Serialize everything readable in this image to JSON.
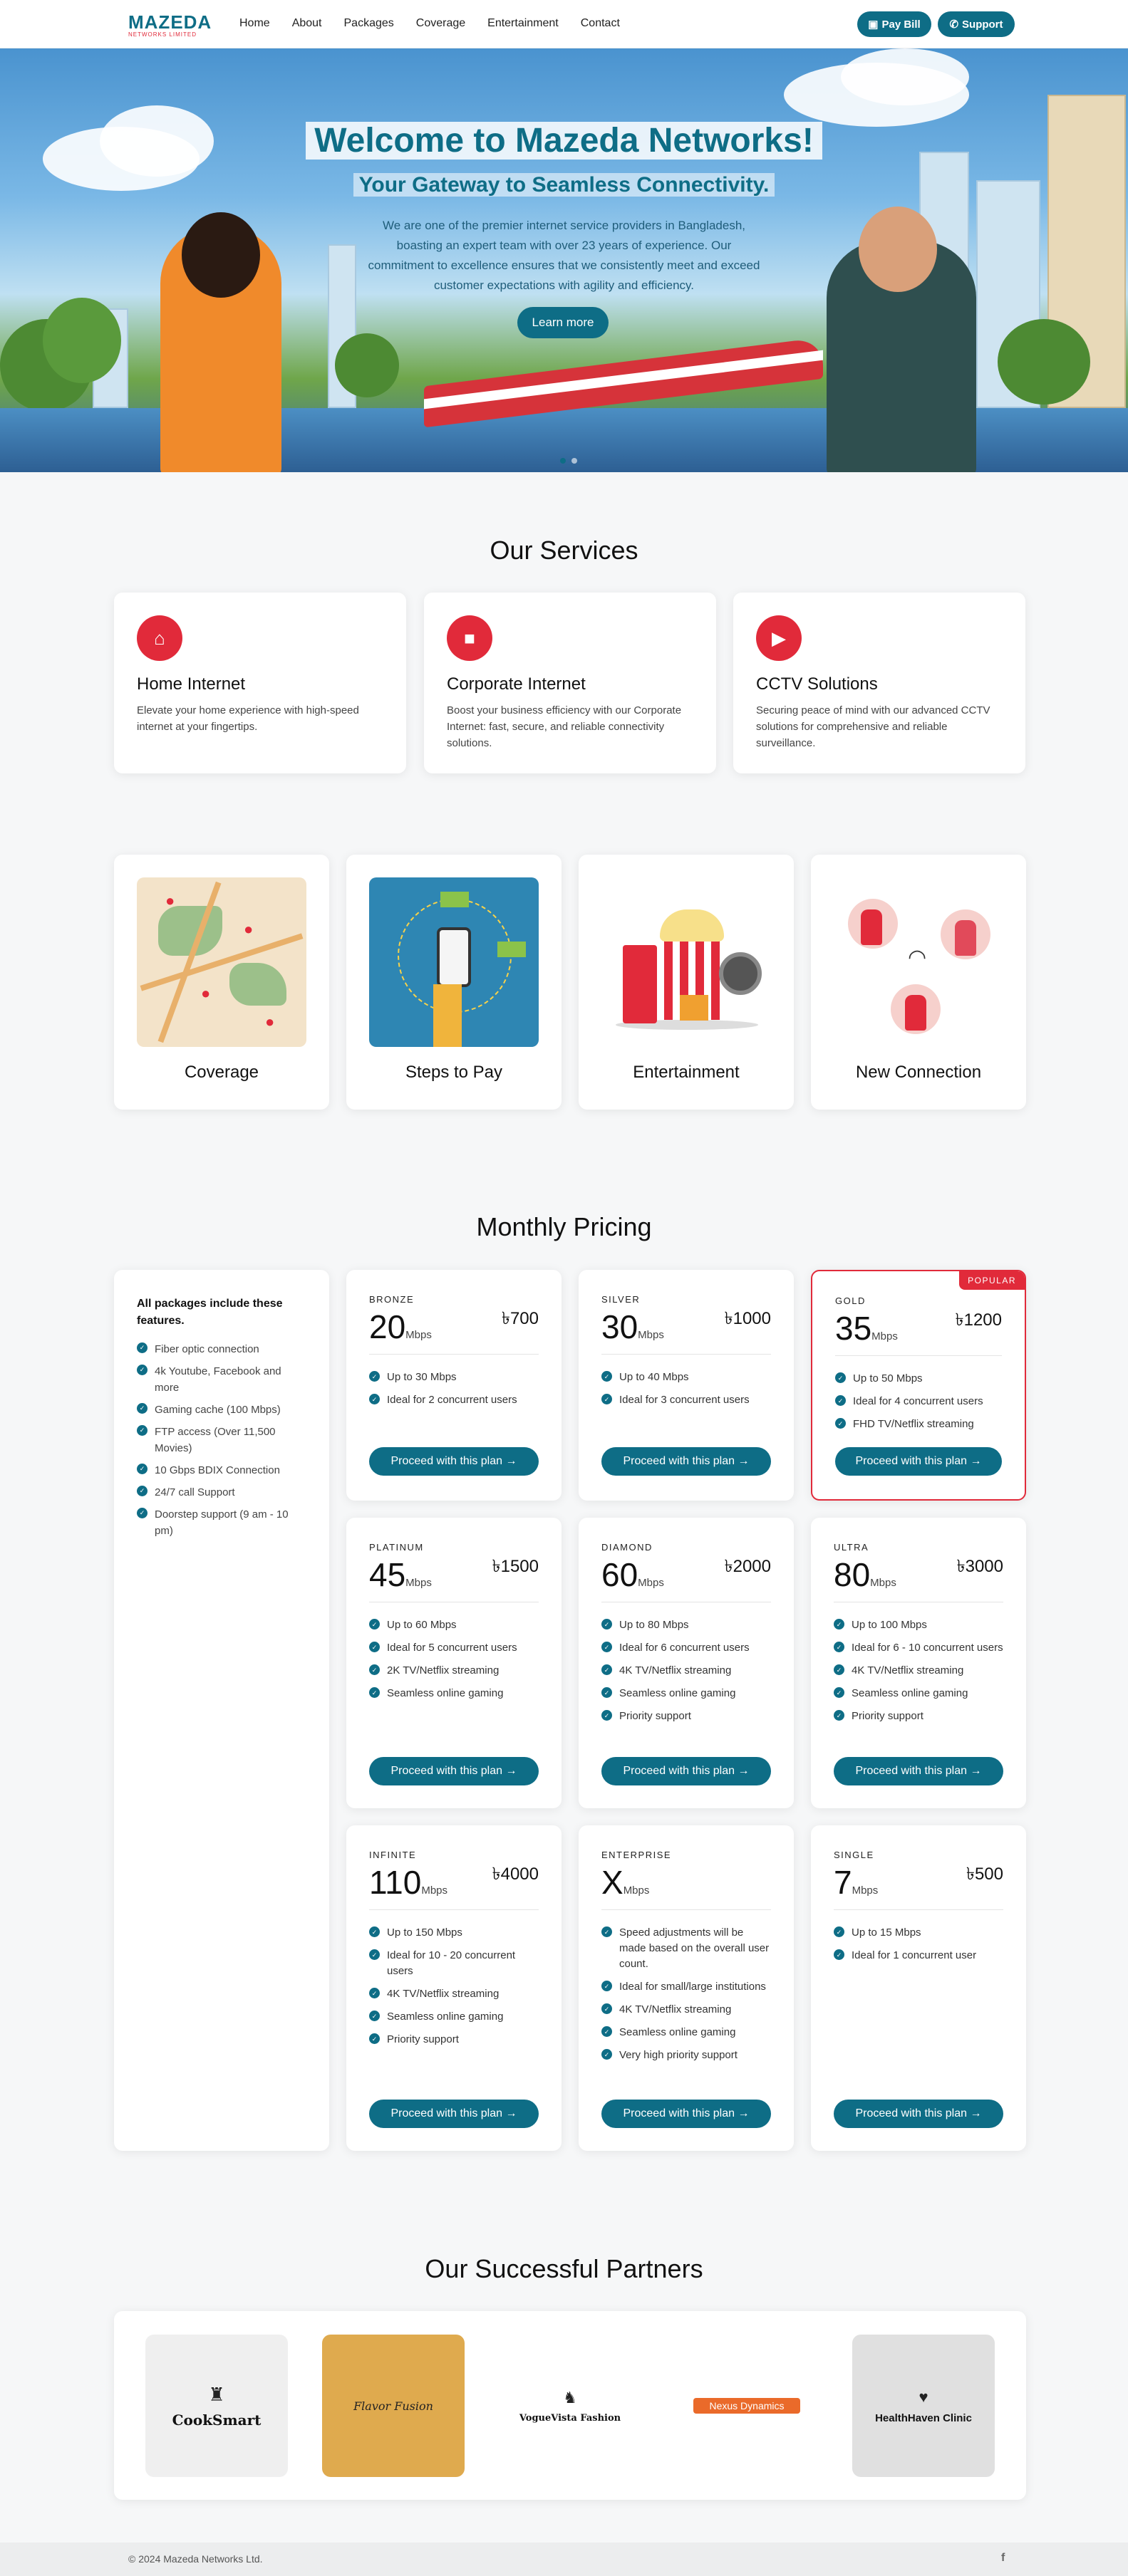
{
  "nav": {
    "logo_main": "MAZEDA",
    "logo_sub": "NETWORKS LIMITED",
    "links": [
      "Home",
      "About",
      "Packages",
      "Coverage",
      "Entertainment",
      "Contact"
    ],
    "pay_bill": "Pay Bill",
    "support": "Support"
  },
  "hero": {
    "title": "Welcome to Mazeda Networks!",
    "subtitle": "Your Gateway to Seamless Connectivity.",
    "text": "We are one of the premier internet service providers in Bangladesh, boasting an expert team with over 23 years of experience. Our commitment to excellence ensures that we consistently meet and exceed customer expectations with agility and efficiency.",
    "button": "Learn more"
  },
  "services": {
    "title": "Our Services",
    "items": [
      {
        "title": "Home Internet",
        "desc": "Elevate your home experience with high-speed internet at your fingertips.",
        "icon": "home-wifi-icon"
      },
      {
        "title": "Corporate Internet",
        "desc": "Boost your business efficiency with our Corporate Internet: fast, secure, and reliable connectivity solutions.",
        "icon": "briefcase-icon"
      },
      {
        "title": "CCTV Solutions",
        "desc": "Securing peace of mind with our advanced CCTV solutions for comprehensive and reliable surveillance.",
        "icon": "video-camera-icon"
      }
    ]
  },
  "features": [
    "Coverage",
    "Steps to Pay",
    "Entertainment",
    "New Connection"
  ],
  "pricing": {
    "title": "Monthly Pricing",
    "includes_title": "All packages include these features.",
    "includes": [
      "Fiber optic connection",
      "4k Youtube, Facebook and more",
      "Gaming cache (100 Mbps)",
      "FTP access (Over 11,500 Movies)",
      "10 Gbps BDIX Connection",
      "24/7 call Support",
      "Doorstep support (9 am - 10 pm)"
    ],
    "unit": "Mbps",
    "button": "Proceed with this plan",
    "popular": "POPULAR",
    "plans": [
      {
        "tier": "BRONZE",
        "speed": "20",
        "price": "৳700",
        "features": [
          "Up to 30 Mbps",
          "Ideal for 2 concurrent users"
        ]
      },
      {
        "tier": "SILVER",
        "speed": "30",
        "price": "৳1000",
        "features": [
          "Up to 40 Mbps",
          "Ideal for 3 concurrent users"
        ]
      },
      {
        "tier": "GOLD",
        "speed": "35",
        "price": "৳1200",
        "features": [
          "Up to 50 Mbps",
          "Ideal for 4 concurrent users",
          "FHD TV/Netflix streaming"
        ]
      },
      {
        "tier": "PLATINUM",
        "speed": "45",
        "price": "৳1500",
        "features": [
          "Up to 60 Mbps",
          "Ideal for 5 concurrent users",
          "2K TV/Netflix streaming",
          "Seamless online gaming"
        ]
      },
      {
        "tier": "DIAMOND",
        "speed": "60",
        "price": "৳2000",
        "features": [
          "Up to 80 Mbps",
          "Ideal for 6 concurrent users",
          "4K TV/Netflix streaming",
          "Seamless online gaming",
          "Priority support"
        ]
      },
      {
        "tier": "ULTRA",
        "speed": "80",
        "price": "৳3000",
        "features": [
          "Up to 100 Mbps",
          "Ideal for 6 - 10 concurrent users",
          "4K TV/Netflix streaming",
          "Seamless online gaming",
          "Priority support"
        ]
      },
      {
        "tier": "INFINITE",
        "speed": "110",
        "price": "৳4000",
        "features": [
          "Up to 150 Mbps",
          "Ideal for 10 - 20 concurrent users",
          "4K TV/Netflix streaming",
          "Seamless online gaming",
          "Priority support"
        ]
      },
      {
        "tier": "ENTERPRISE",
        "speed": "X",
        "price": "",
        "features": [
          "Speed adjustments will be made based on the overall user count.",
          "Ideal for small/large institutions",
          "4K TV/Netflix streaming",
          "Seamless online gaming",
          "Very high priority support"
        ]
      },
      {
        "tier": "SINGLE",
        "speed": "7",
        "price": "৳500",
        "features": [
          "Up to 15 Mbps",
          "Ideal for 1 concurrent user"
        ]
      }
    ]
  },
  "partners": {
    "title": "Our Successful Partners",
    "items": [
      "CookSmart",
      "Flavor Fusion",
      "VogueVista Fashion",
      "Nexus Dynamics",
      "HealthHaven Clinic"
    ]
  },
  "footer": {
    "copyright": "© 2024 Mazeda Networks Ltd.",
    "social": "f"
  },
  "colors": {
    "primary": "#0e6d86",
    "accent": "#e12a3a",
    "background": "#f6f7f8"
  }
}
